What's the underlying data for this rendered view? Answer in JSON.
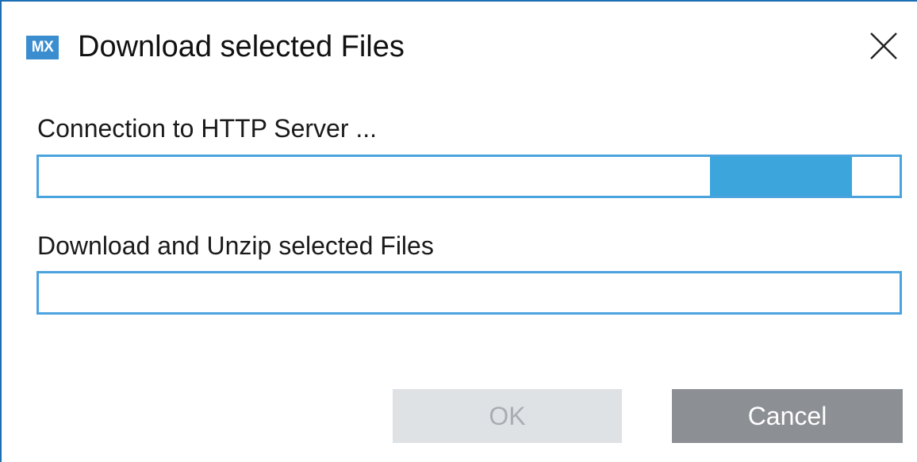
{
  "window": {
    "app_icon_text": "MX",
    "title": "Download selected Files",
    "close_icon": "close-icon"
  },
  "sections": [
    {
      "label": "Connection to HTTP Server ...",
      "progress": {
        "type": "indeterminate-marquee",
        "segment_start_fraction": 0.78,
        "segment_end_fraction": 0.945
      }
    },
    {
      "label": "Download and Unzip selected Files",
      "progress": {
        "type": "determinate",
        "value_fraction": 0.0
      }
    }
  ],
  "buttons": {
    "ok_label": "OK",
    "ok_enabled": false,
    "cancel_label": "Cancel",
    "cancel_enabled": true
  },
  "colors": {
    "accent": "#3ba5dc",
    "progress_border": "#4ba3dd",
    "ok_disabled_bg": "#dfe2e5",
    "cancel_bg": "#8c8f94",
    "icon_bg": "#3a8ed0"
  }
}
